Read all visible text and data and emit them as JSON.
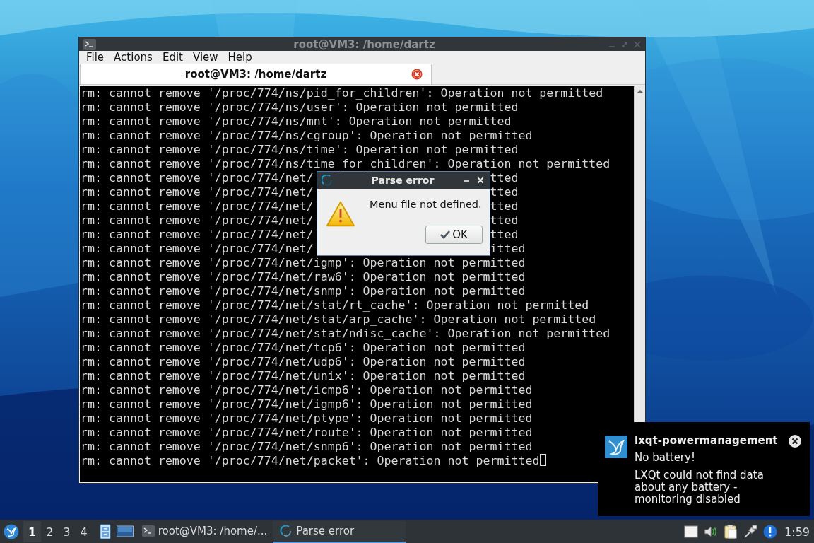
{
  "terminal_window": {
    "title": "root@VM3: /home/dartz",
    "menu": [
      "File",
      "Actions",
      "Edit",
      "View",
      "Help"
    ],
    "tabs": [
      {
        "label": "root@VM3: /home/dartz",
        "selected": true
      }
    ],
    "lines": [
      {
        "kind": "full",
        "text": "rm: cannot remove '/proc/774/ns/pid_for_children': Operation not permitted"
      },
      {
        "kind": "full",
        "text": "rm: cannot remove '/proc/774/ns/user': Operation not permitted"
      },
      {
        "kind": "full",
        "text": "rm: cannot remove '/proc/774/ns/mnt': Operation not permitted"
      },
      {
        "kind": "full",
        "text": "rm: cannot remove '/proc/774/ns/cgroup': Operation not permitted"
      },
      {
        "kind": "full",
        "text": "rm: cannot remove '/proc/774/ns/time': Operation not permitted"
      },
      {
        "kind": "full",
        "text": "rm: cannot remove '/proc/774/ns/time_for_children': Operation not permitted"
      },
      {
        "kind": "covered",
        "left": "rm: cannot remove '/proc/774/net/",
        "right": "tted"
      },
      {
        "kind": "covered",
        "left": "rm: cannot remove '/proc/774/net/",
        "right": "tted"
      },
      {
        "kind": "covered",
        "left": "rm: cannot remove '/proc/774/net/",
        "right": "tted"
      },
      {
        "kind": "covered",
        "left": "rm: cannot remove '/proc/774/net/",
        "right": "tted"
      },
      {
        "kind": "covered",
        "left": "rm: cannot remove '/proc/774/net/",
        "right": "tted"
      },
      {
        "kind": "covered",
        "left": "rm: cannot remove '/proc/774/net/",
        "right": "itted"
      },
      {
        "kind": "full",
        "text": "rm: cannot remove '/proc/774/net/igmp': Operation not permitted"
      },
      {
        "kind": "full",
        "text": "rm: cannot remove '/proc/774/net/raw6': Operation not permitted"
      },
      {
        "kind": "full",
        "text": "rm: cannot remove '/proc/774/net/snmp': Operation not permitted"
      },
      {
        "kind": "full",
        "text": "rm: cannot remove '/proc/774/net/stat/rt_cache': Operation not permitted"
      },
      {
        "kind": "full",
        "text": "rm: cannot remove '/proc/774/net/stat/arp_cache': Operation not permitted"
      },
      {
        "kind": "full",
        "text": "rm: cannot remove '/proc/774/net/stat/ndisc_cache': Operation not permitted"
      },
      {
        "kind": "full",
        "text": "rm: cannot remove '/proc/774/net/tcp6': Operation not permitted"
      },
      {
        "kind": "full",
        "text": "rm: cannot remove '/proc/774/net/udp6': Operation not permitted"
      },
      {
        "kind": "full",
        "text": "rm: cannot remove '/proc/774/net/unix': Operation not permitted"
      },
      {
        "kind": "full",
        "text": "rm: cannot remove '/proc/774/net/icmp6': Operation not permitted"
      },
      {
        "kind": "full",
        "text": "rm: cannot remove '/proc/774/net/igmp6': Operation not permitted"
      },
      {
        "kind": "full",
        "text": "rm: cannot remove '/proc/774/net/ptype': Operation not permitted"
      },
      {
        "kind": "full",
        "text": "rm: cannot remove '/proc/774/net/route': Operation not permitted"
      },
      {
        "kind": "full",
        "text": "rm: cannot remove '/proc/774/net/snmp6': Operation not permitted"
      },
      {
        "kind": "full",
        "text": "rm: cannot remove '/proc/774/net/packet': Operation not permitted"
      }
    ],
    "cursor": true
  },
  "dialog": {
    "title": "Parse error",
    "message": "Menu file not defined.",
    "buttons": [
      "OK"
    ]
  },
  "notification": {
    "app": "lxqt-powermanagement",
    "summary": "No battery!",
    "body": "LXQt could not find data about any battery - monitoring disabled"
  },
  "taskbar": {
    "desktops": [
      {
        "label": "1",
        "selected": true
      },
      {
        "label": "2",
        "selected": false
      },
      {
        "label": "3",
        "selected": false
      },
      {
        "label": "4",
        "selected": false
      }
    ],
    "tasks": [
      {
        "label": "root@VM3: /home/...",
        "kind": "terminal",
        "selected": false
      },
      {
        "label": "Parse error",
        "kind": "app",
        "selected": true
      }
    ],
    "clock": "1:59"
  }
}
